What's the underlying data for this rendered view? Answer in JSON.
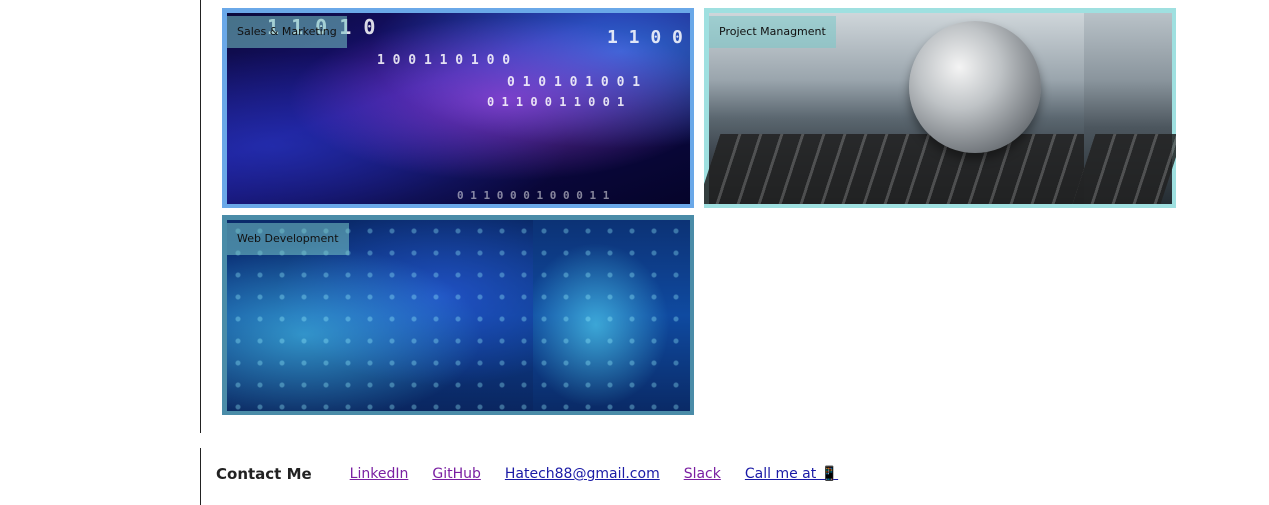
{
  "portfolio": {
    "cards": [
      {
        "label": "Sales & Marketing"
      },
      {
        "label": "Project Managment"
      },
      {
        "label": "Web Development"
      }
    ]
  },
  "footer": {
    "title": "Contact Me",
    "links": [
      {
        "label": "LinkedIn"
      },
      {
        "label": "GitHub"
      },
      {
        "label": "Hatech88@gmail.com"
      },
      {
        "label": "Slack"
      },
      {
        "label": "Call me at 📱"
      }
    ]
  },
  "colors": {
    "visited_link": "#7a1fa2",
    "link": "#1a1aa6"
  }
}
